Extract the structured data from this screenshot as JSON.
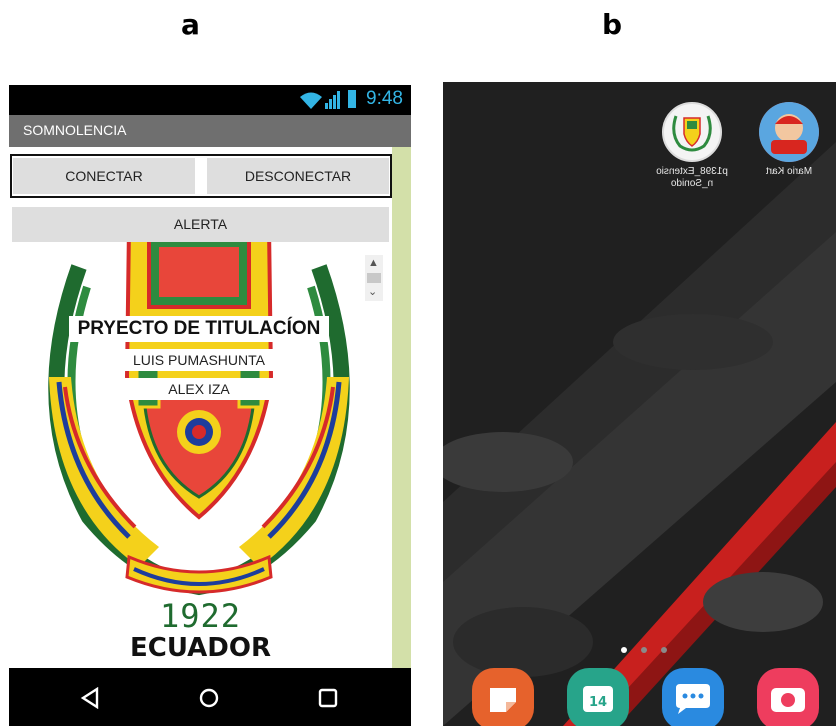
{
  "labels": {
    "a": "a",
    "b": "b"
  },
  "phone_a": {
    "status_time": "9:48",
    "app_title": "SOMNOLENCIA",
    "buttons": {
      "connect": "CONECTAR",
      "disconnect": "DESCONECTAR",
      "alert": "ALERTA"
    },
    "project_title": "PRYECTO DE TITULACÍON",
    "author1": "LUIS PUMASHUNTA",
    "author2": "ALEX IZA",
    "crest_year": "1922",
    "crest_country": "ECUADOR"
  },
  "phone_b": {
    "apps": [
      {
        "label": "p1398_Extensio n_Sonido",
        "icon": "crest-icon"
      },
      {
        "label": "Mario Kart",
        "icon": "mario-kart-icon"
      }
    ],
    "page_indicator": {
      "pages": 3,
      "current": 1
    },
    "dock": [
      "notes-icon",
      "calendar-icon",
      "messages-icon",
      "camera-icon"
    ],
    "colors": {
      "accent_red": "#c8201e",
      "wallpaper_dark": "#1d1d1d"
    }
  }
}
